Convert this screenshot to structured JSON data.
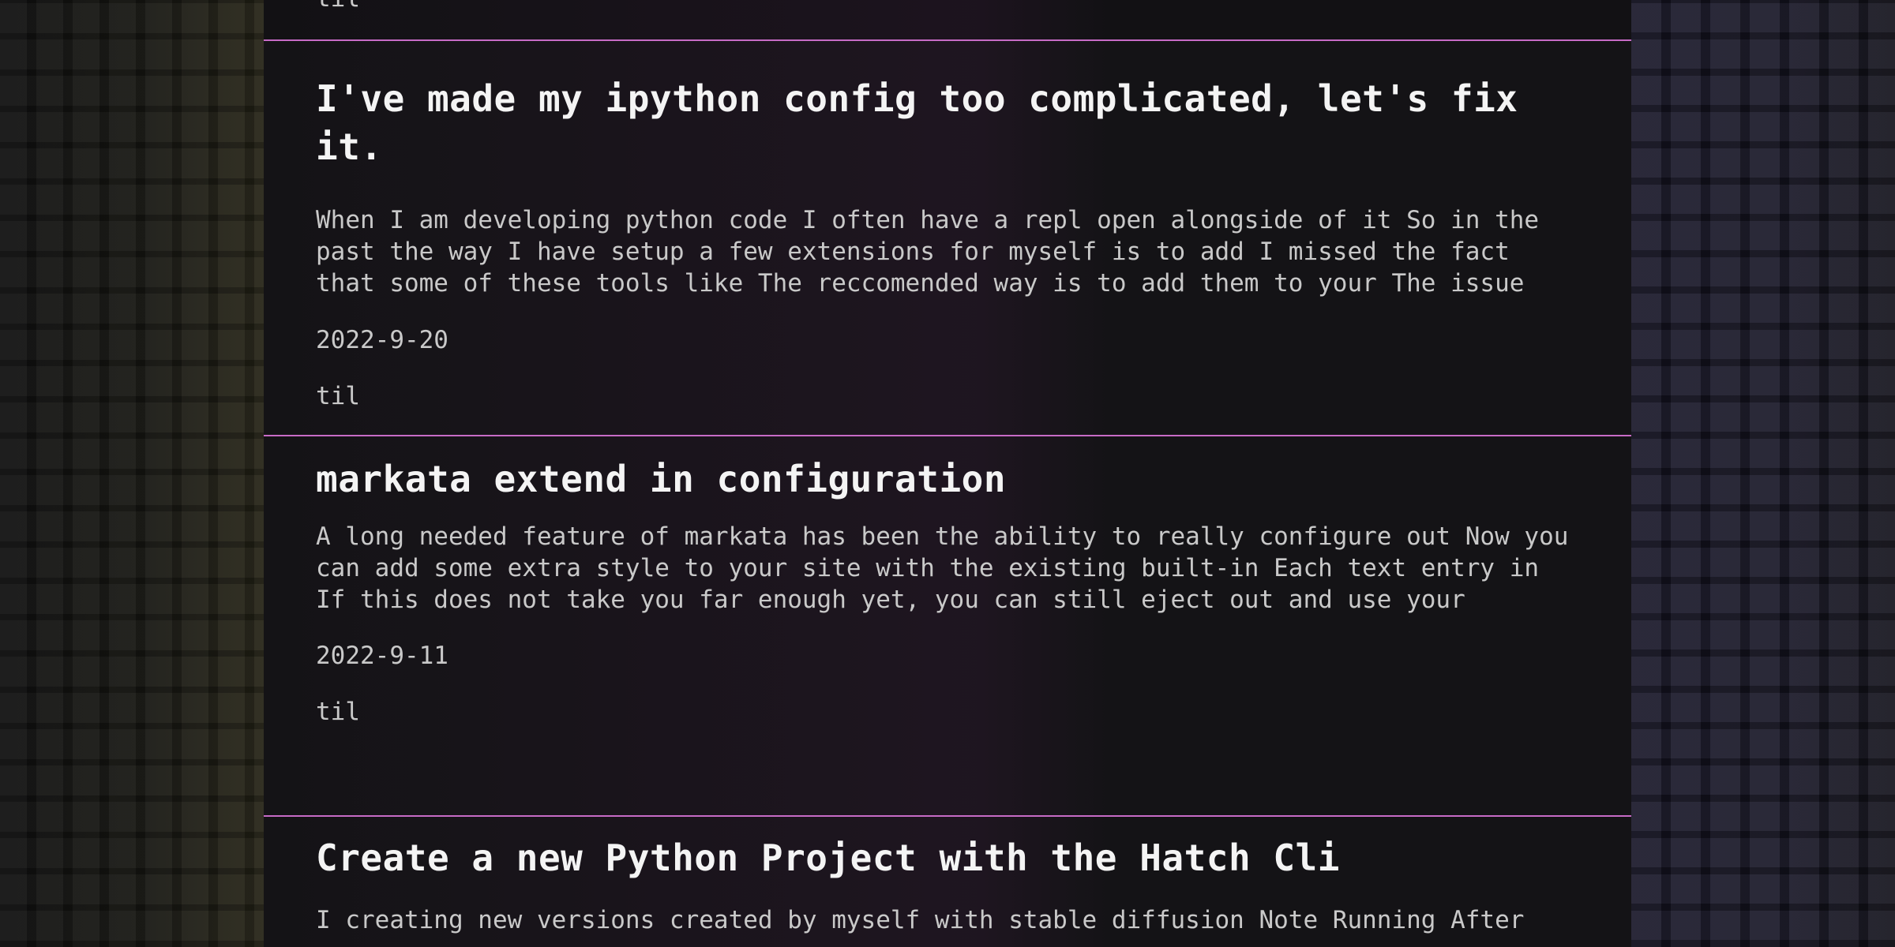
{
  "posts": [
    {
      "tag": "til"
    },
    {
      "title": "I've made my ipython config too complicated, let's fix it.",
      "description": "When I am developing python code I often have a repl open alongside of it So in the past the way I have setup a few extensions for myself is to add I missed the fact that some of these tools like The reccomended way is to add them to your The issue",
      "date": "2022-9-20",
      "tag": "til"
    },
    {
      "title": "markata extend in configuration",
      "description": "A long needed feature of markata has been the ability to really configure out Now you can add some extra style to your site with the existing built-in Each text entry in If this does not take you far enough yet, you can still eject out and use your",
      "date": "2022-9-11",
      "tag": "til"
    },
    {
      "title": "Create a new Python Project with the Hatch Cli",
      "description": "I creating new versions created by myself with stable diffusion Note Running After"
    }
  ],
  "colors": {
    "accent": "#c76bc6",
    "background": "#121114",
    "title_text": "#f4f4f4",
    "body_text": "#c9c9c9"
  }
}
